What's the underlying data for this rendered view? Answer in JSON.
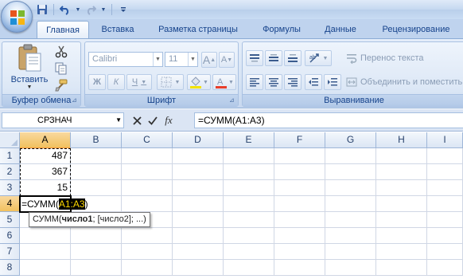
{
  "title_bar": {
    "icons": [
      "office-logo-icon",
      "save-icon",
      "undo-icon",
      "redo-icon",
      "customize-qat-icon"
    ]
  },
  "tabs": [
    {
      "label": "Главная",
      "active": true
    },
    {
      "label": "Вставка",
      "active": false
    },
    {
      "label": "Разметка страницы",
      "active": false
    },
    {
      "label": "Формулы",
      "active": false
    },
    {
      "label": "Данные",
      "active": false
    },
    {
      "label": "Рецензирование",
      "active": false
    }
  ],
  "ribbon": {
    "clipboard": {
      "label": "Буфер обмена",
      "paste_label": "Вставить",
      "icons": [
        "paste-icon",
        "cut-icon",
        "copy-icon",
        "format-painter-icon"
      ]
    },
    "font": {
      "label": "Шрифт",
      "font_name": "Calibri",
      "font_size": "11",
      "grow_label": "A",
      "shrink_label": "A",
      "bold_label": "Ж",
      "italic_label": "К",
      "underline_label": "Ч",
      "icons": [
        "borders-icon",
        "fill-color-icon",
        "font-color-icon"
      ]
    },
    "alignment": {
      "label": "Выравнивание",
      "wrap_text_label": "Перенос текста",
      "merge_label": "Объединить и поместить",
      "icons": [
        "align-top-icon",
        "align-middle-icon",
        "align-bottom-icon",
        "orientation-icon",
        "align-left-icon",
        "align-center-icon",
        "align-right-icon",
        "decrease-indent-icon",
        "increase-indent-icon"
      ]
    }
  },
  "formula_bar": {
    "name_box": "СРЗНАЧ",
    "fx_label": "fx",
    "formula": "=СУММ(A1:A3)"
  },
  "sheet": {
    "columns": [
      "A",
      "B",
      "C",
      "D",
      "E",
      "F",
      "G",
      "H",
      "I"
    ],
    "selected_column": "A",
    "rows": [
      "1",
      "2",
      "3",
      "4",
      "5",
      "6",
      "7",
      "8"
    ],
    "selected_row": "4",
    "cells": {
      "A1": "487",
      "A2": "367",
      "A3": "15"
    },
    "edit_cell": {
      "prefix": "=СУММ(",
      "ref": "A1:A3",
      "suffix": ")"
    },
    "tooltip": {
      "func": "СУММ(",
      "arg1": "число1",
      "rest": "; [число2]; ...)"
    }
  },
  "colors": {
    "ribbon_bg": "#dbe6f4",
    "header_selected": "#f5c365",
    "ref_highlight_bg": "#000000",
    "ref_highlight_fg": "#fdd700"
  }
}
